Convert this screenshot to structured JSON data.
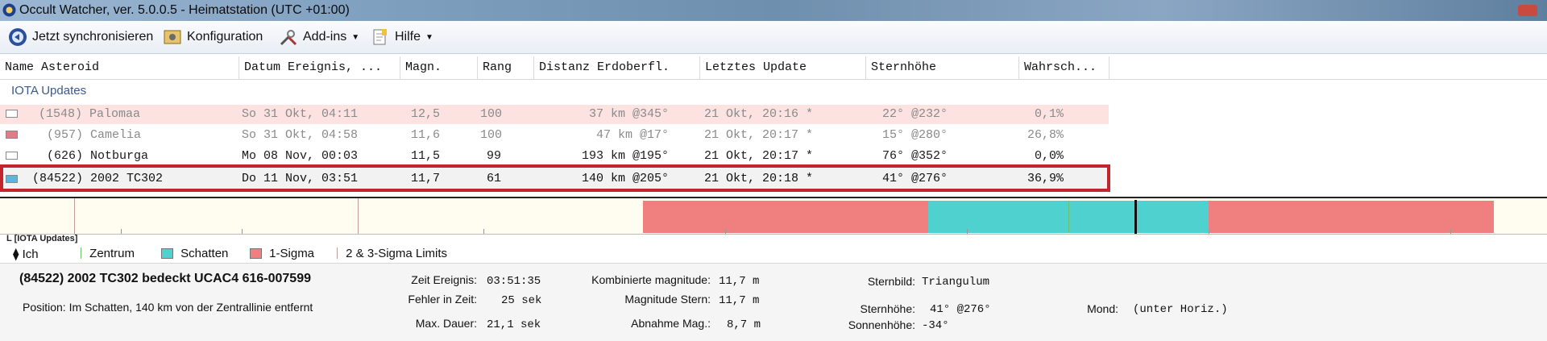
{
  "window": {
    "title": "Occult Watcher, ver. 5.0.0.5 - Heimatstation (UTC +01:00)"
  },
  "toolbar": {
    "sync_label": "Jetzt synchronisieren",
    "config_label": "Konfiguration",
    "addins_label": "Add-ins",
    "help_label": "Hilfe"
  },
  "grid": {
    "columns": [
      "Name Asteroid",
      "Datum Ereignis, ...",
      "Magn.",
      "Rang",
      "Distanz Erdoberfl.",
      "Letztes Update",
      "Sternhöhe",
      "Wahrsch..."
    ],
    "group_label": "IOTA Updates",
    "rows": [
      {
        "name": "(1548) Palomaa",
        "date": "So 31 Okt, 04:11",
        "mag": "12,5",
        "rank": "100",
        "dist": "37 km @345°",
        "update": "21 Okt, 20:16 *",
        "alt": "22° @232°",
        "prob": "0,1%",
        "swatch": "#ffffff"
      },
      {
        "name": "(957) Camelia",
        "date": "So 31 Okt, 04:58",
        "mag": "11,6",
        "rank": "100",
        "dist": "47 km @17°",
        "update": "21 Okt, 20:17 *",
        "alt": "15° @280°",
        "prob": "26,8%",
        "swatch": "#e37b86"
      },
      {
        "name": "(626) Notburga",
        "date": "Mo 08 Nov, 00:03",
        "mag": "11,5",
        "rank": "99",
        "dist": "193 km @195°",
        "update": "21 Okt, 20:17 *",
        "alt": "76° @352°",
        "prob": "0,0%",
        "swatch": "#ffffff"
      },
      {
        "name": "(84522) 2002 TC302",
        "date": "Do 11 Nov, 03:51",
        "mag": "11,7",
        "rank": "61",
        "dist": "140 km @205°",
        "update": "21 Okt, 20:18 *",
        "alt": "41° @276°",
        "prob": "36,9%",
        "swatch": "#5fb5d9"
      }
    ]
  },
  "timeline": {
    "caption": "L [IOTA Updates]"
  },
  "legend": {
    "me": "Ich",
    "center": "Zentrum",
    "shadow": "Schatten",
    "sigma1": "1-Sigma",
    "sigma23": "2 & 3-Sigma Limits",
    "colors": {
      "shadow": "#4fd2cf",
      "sigma1": "#f08080",
      "center": "#6dc06d"
    }
  },
  "details": {
    "title": "(84522) 2002 TC302 bedeckt UCAC4 616-007599",
    "position": "Position:  Im Schatten, 140 km von der Zentrallinie entfernt",
    "event_time_label": "Zeit Ereignis:",
    "event_time": "03:51:35",
    "time_error_label": "Fehler in Zeit:",
    "time_error": "25 sek",
    "max_duration_label": "Max. Dauer:",
    "max_duration": "21,1 sek",
    "combined_mag_label": "Kombinierte magnitude:",
    "combined_mag": "11,7 m",
    "star_mag_label": "Magnitude Stern:",
    "star_mag": "11,7 m",
    "mag_drop_label": "Abnahme Mag.:",
    "mag_drop": "8,7 m",
    "constellation_label": "Sternbild:",
    "constellation": "Triangulum",
    "star_alt_label": "Sternhöhe:",
    "star_alt": "41° @276°",
    "sun_alt_label": "Sonnenhöhe:",
    "sun_alt": "-34°",
    "moon_label": "Mond:",
    "moon": "(unter Horiz.)"
  }
}
